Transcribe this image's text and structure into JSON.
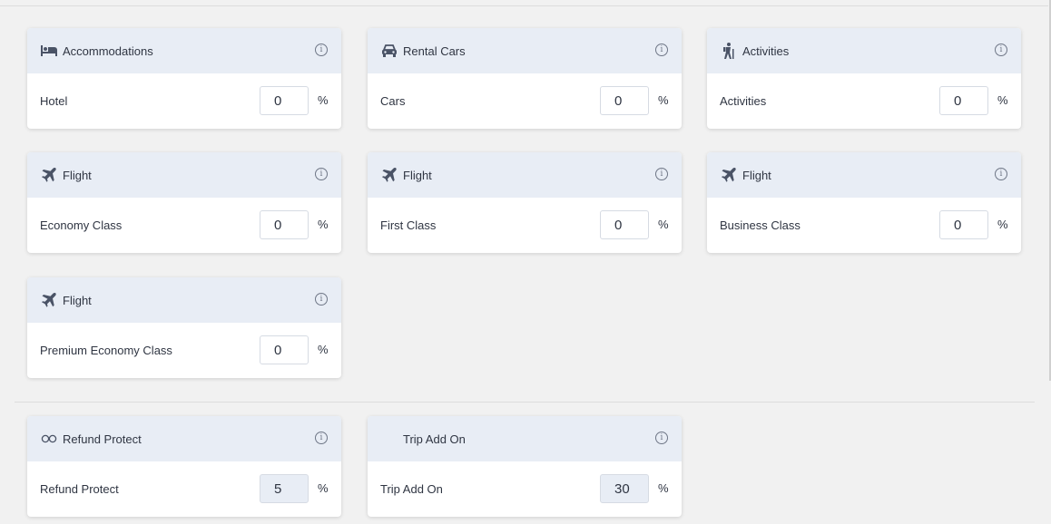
{
  "cards": [
    {
      "title": "Accommodations",
      "icon": "bed-icon",
      "label": "Hotel",
      "value": "0",
      "unit": "%"
    },
    {
      "title": "Rental Cars",
      "icon": "car-icon",
      "label": "Cars",
      "value": "0",
      "unit": "%"
    },
    {
      "title": "Activities",
      "icon": "hiker-icon",
      "label": "Activities",
      "value": "0",
      "unit": "%"
    },
    {
      "title": "Flight",
      "icon": "plane-icon",
      "label": "Economy Class",
      "value": "0",
      "unit": "%"
    },
    {
      "title": "Flight",
      "icon": "plane-icon",
      "label": "First Class",
      "value": "0",
      "unit": "%"
    },
    {
      "title": "Flight",
      "icon": "plane-icon",
      "label": "Business Class",
      "value": "0",
      "unit": "%"
    },
    {
      "title": "Flight",
      "icon": "plane-icon",
      "label": "Premium Economy Class",
      "value": "0",
      "unit": "%"
    }
  ],
  "addons": [
    {
      "title": "Refund Protect",
      "icon": "infinity-icon",
      "label": "Refund Protect",
      "value": "5",
      "unit": "%"
    },
    {
      "title": "Trip Add On",
      "icon": "",
      "label": "Trip Add On",
      "value": "30",
      "unit": "%"
    }
  ],
  "info_glyph": "i",
  "colors": {
    "page": "#f1f1f1",
    "card_header": "#e8edf5",
    "icon": "#4a5366",
    "text": "#2f3542"
  }
}
